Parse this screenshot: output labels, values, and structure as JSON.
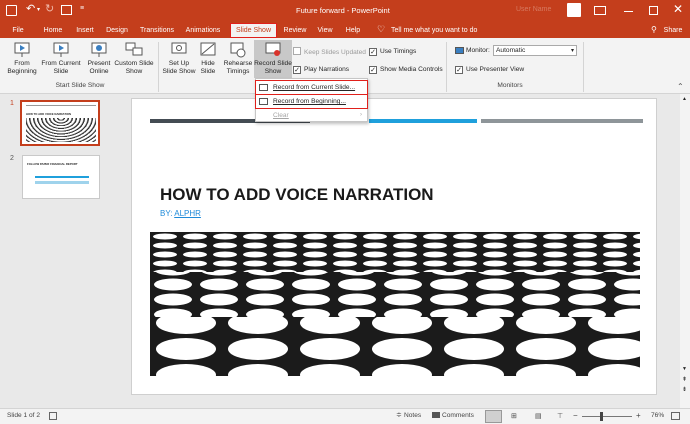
{
  "titlebar": {
    "title": "Future forward - PowerPoint",
    "user": "User Name"
  },
  "tabs": [
    "File",
    "Home",
    "Insert",
    "Design",
    "Transitions",
    "Animations",
    "Slide Show",
    "Review",
    "View",
    "Help"
  ],
  "tell_me": "Tell me what you want to do",
  "share": "Share",
  "ribbon": {
    "from_beginning": "From Beginning",
    "from_current": "From Current Slide",
    "present_online": "Present Online",
    "custom_show": "Custom Slide Show",
    "group_start": "Start Slide Show",
    "setup": "Set Up Slide Show",
    "hide": "Hide Slide",
    "rehearse": "Rehearse Timings",
    "record": "Record Slide Show",
    "keep_updated": "Keep Slides Updated",
    "play_narrations": "Play Narrations",
    "use_timings": "Use Timings",
    "show_media": "Show Media Controls",
    "monitor_label": "Monitor:",
    "monitor_value": "Automatic",
    "presenter_view": "Use Presenter View",
    "group_monitors": "Monitors"
  },
  "menu": {
    "record_current": "Record from Current Slide...",
    "record_beginning": "Record from Beginning...",
    "clear": "Clear"
  },
  "slide": {
    "title": "HOW TO ADD VOICE NARRATION",
    "subtitle_prefix": "BY: ",
    "subtitle_link": "ALPHR"
  },
  "thumbs": {
    "n1": "1",
    "n2": "2",
    "t1": "HOW TO ADD VOICE NARRATION",
    "t2": "FOLLOW PAPER FINANCIAL REPORT"
  },
  "status": {
    "slide_count": "Slide 1 of 2",
    "notes": "Notes",
    "comments": "Comments",
    "zoom": "76%"
  },
  "colors": {
    "accent": "#c43e1c",
    "highlight": "#e0201b",
    "link": "#1f8ad9",
    "bar_blue": "#1fa0dc",
    "bar_dark": "#444c53",
    "bar_gray": "#8e9599"
  }
}
